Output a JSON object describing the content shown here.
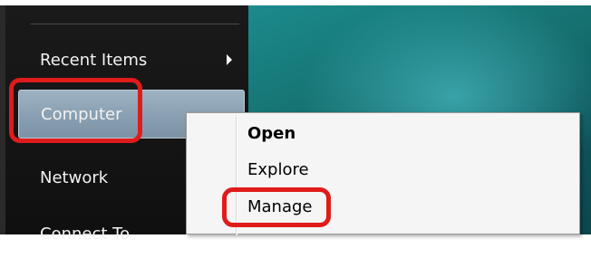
{
  "start_menu": {
    "items": [
      {
        "label": "Recent Items",
        "has_submenu": true
      },
      {
        "label": "Computer",
        "hovered": true
      },
      {
        "label": "Network"
      },
      {
        "label": "Connect To"
      }
    ]
  },
  "context_menu": {
    "items": [
      {
        "label": "Open",
        "default": true
      },
      {
        "label": "Explore"
      },
      {
        "label": "Manage"
      }
    ]
  },
  "annotations": {
    "highlight_color": "#e01b1b"
  }
}
